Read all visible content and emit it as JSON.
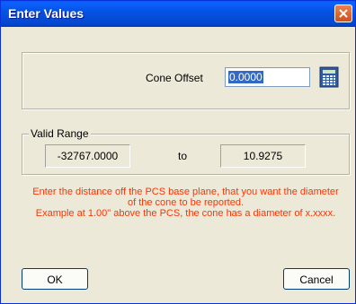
{
  "window": {
    "title": "Enter Values"
  },
  "offset": {
    "label": "Cone Offset",
    "value": "0.0000"
  },
  "range": {
    "legend": "Valid Range",
    "min": "-32767.0000",
    "to": "to",
    "max": "10.9275"
  },
  "help": {
    "line1": "Enter the distance off the PCS base plane, that you want the diameter",
    "line2": "of the cone to be reported.",
    "line3": "Example at 1.00\" above the PCS, the cone has a diameter of x.xxxx."
  },
  "buttons": {
    "ok": "OK",
    "cancel": "Cancel"
  },
  "colors": {
    "help_text": "#ff3300",
    "titlebar": "#0453e3",
    "close": "#d24f1b"
  },
  "icons": {
    "close": "close-icon",
    "calculator": "calculator-icon"
  }
}
